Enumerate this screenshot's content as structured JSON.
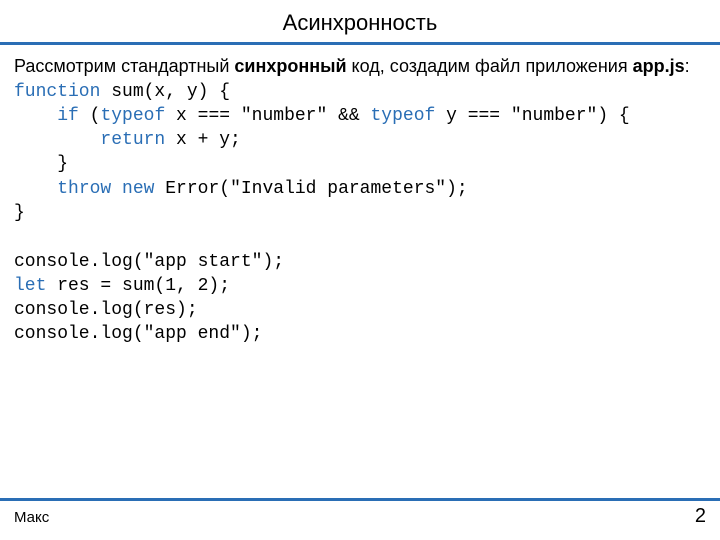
{
  "header": {
    "title": "Асинхронность"
  },
  "intro": {
    "before": "Рассмотрим стандартный ",
    "bold": "синхронный",
    "after": " код, создадим файл приложения ",
    "file": "app.js",
    "colon": ":"
  },
  "code": {
    "l1": {
      "a": "function",
      "b": " sum(x, y) {"
    },
    "l2": {
      "a": "    ",
      "b": "if",
      "c": " (",
      "d": "typeof",
      "e": " x === \"number\" && ",
      "f": "typeof",
      "g": " y === \"number\") {"
    },
    "l3": {
      "a": "        ",
      "b": "return",
      "c": " x + y;"
    },
    "l4": "    }",
    "l5": {
      "a": "    ",
      "b": "throw",
      "c": " ",
      "d": "new",
      "e": " Error(\"Invalid parameters\");"
    },
    "l6": "}",
    "l7": "",
    "l8": "console.log(\"app start\");",
    "l9": {
      "a": "let",
      "b": " res = sum(1, 2);"
    },
    "l10": "console.log(res);",
    "l11": "console.log(\"app end\");"
  },
  "footer": {
    "author": "Макс",
    "page": "2"
  }
}
